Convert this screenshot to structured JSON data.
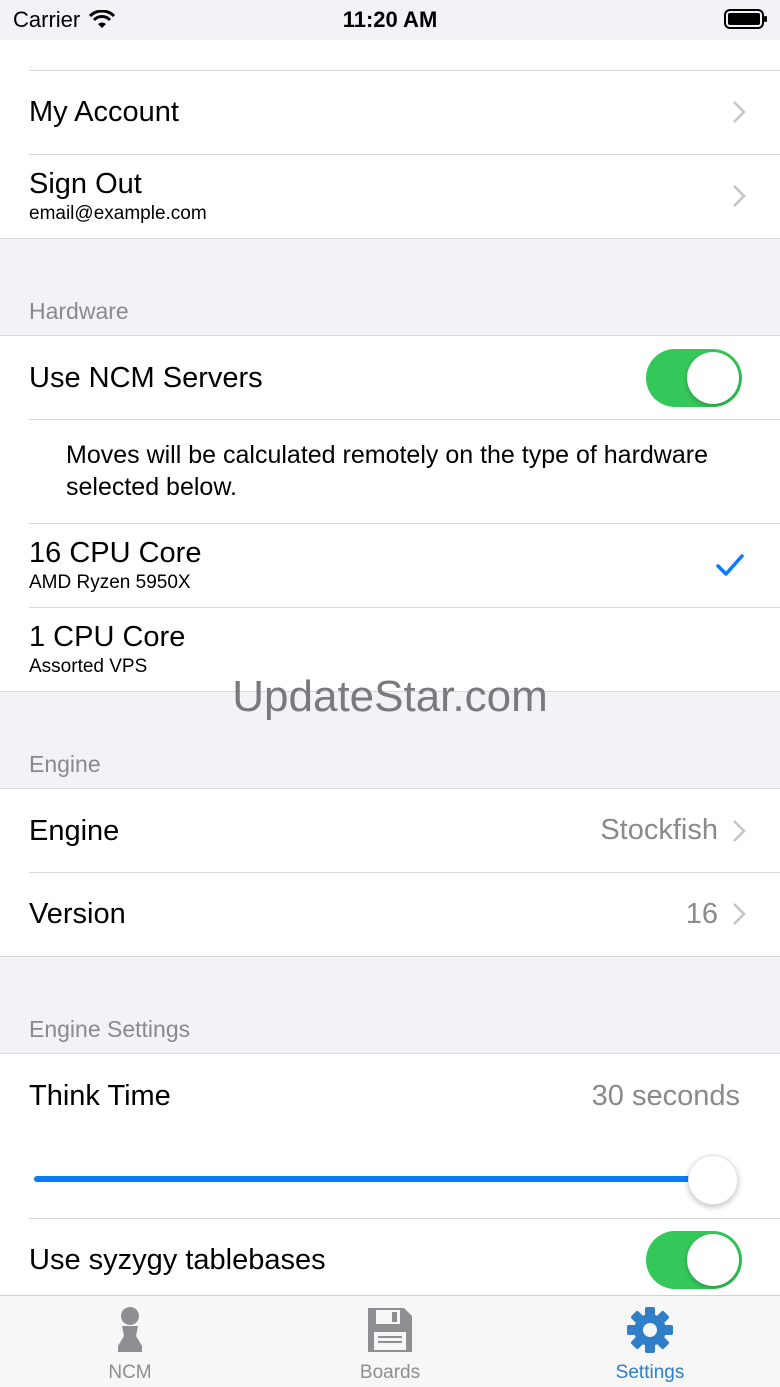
{
  "status_bar": {
    "carrier": "Carrier",
    "time": "11:20 AM"
  },
  "account_group": {
    "my_account": "My Account",
    "sign_out": "Sign Out",
    "email": "email@example.com"
  },
  "hardware": {
    "header": "Hardware",
    "use_servers_label": "Use NCM Servers",
    "use_servers_on": true,
    "footnote": "Moves will be calculated remotely on the type of hardware selected below.",
    "options": [
      {
        "title": "16 CPU Core",
        "subtitle": "AMD Ryzen 5950X",
        "selected": true
      },
      {
        "title": "1 CPU Core",
        "subtitle": "Assorted VPS",
        "selected": false
      }
    ]
  },
  "engine": {
    "header": "Engine",
    "engine_label": "Engine",
    "engine_value": "Stockfish",
    "version_label": "Version",
    "version_value": "16"
  },
  "engine_settings": {
    "header": "Engine Settings",
    "think_time_label": "Think Time",
    "think_time_value": "30 seconds",
    "think_time_slider_fraction": 1.0,
    "syzygy_label": "Use syzygy tablebases",
    "syzygy_on": true
  },
  "watermark": "UpdateStar.com",
  "tabs": [
    {
      "label": "NCM",
      "icon": "pawn-icon",
      "active": false
    },
    {
      "label": "Boards",
      "icon": "floppy-disk-icon",
      "active": false
    },
    {
      "label": "Settings",
      "icon": "gear-icon",
      "active": true
    }
  ],
  "colors": {
    "accent": "#0a7aff",
    "toggle_on": "#34c759",
    "tab_active": "#2f7ec8",
    "tab_inactive": "#8e8e93"
  }
}
